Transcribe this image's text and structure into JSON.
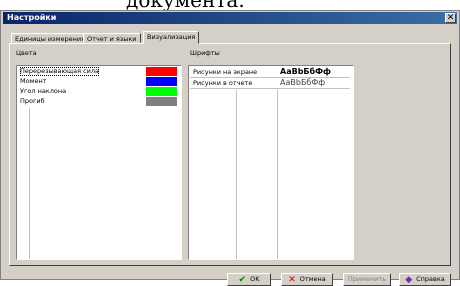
{
  "background_fragment": {
    "text": "документа."
  },
  "window": {
    "title": "Настройки",
    "close_glyph": "✕"
  },
  "tabs": [
    {
      "label": "Единицы измерения"
    },
    {
      "label": "Отчет и языки"
    },
    {
      "label": "Визуализация",
      "active": true
    }
  ],
  "colors_group": {
    "label": "Цвета",
    "items": [
      {
        "label": "Перерезывающая сила",
        "color": "#ff0000",
        "selected": true
      },
      {
        "label": "Момент",
        "color": "#0000ff"
      },
      {
        "label": "Угол наклона",
        "color": "#00ff00"
      },
      {
        "label": "Прогиб",
        "color": "#808080"
      }
    ]
  },
  "fonts_group": {
    "label": "Шрифты",
    "items": [
      {
        "label": "Рисунки на экране",
        "sample": "AaBbБбФф"
      },
      {
        "label": "Рисунки в отчете",
        "sample": "AaBbБбФф"
      }
    ]
  },
  "buttons": {
    "ok": {
      "label": "OK",
      "icon": "checkmark-icon",
      "icon_color": "#008000"
    },
    "cancel": {
      "label": "Отмена",
      "icon": "cross-icon",
      "icon_color": "#cc0000"
    },
    "apply": {
      "label": "Применить",
      "disabled": true
    },
    "help": {
      "label": "Справка",
      "icon": "help-book-icon"
    }
  }
}
